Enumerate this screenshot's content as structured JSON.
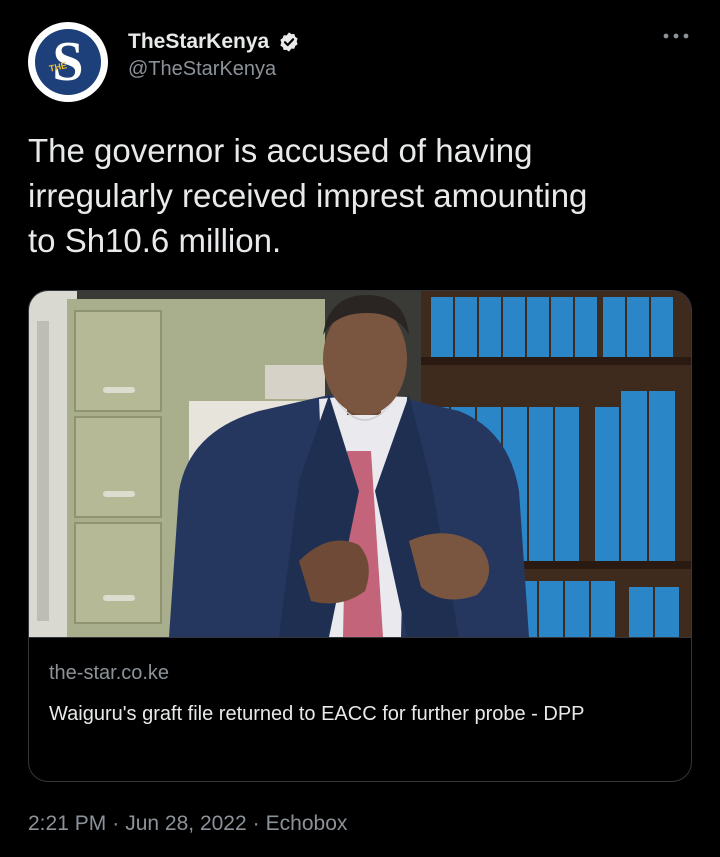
{
  "account": {
    "display_name": "TheStarKenya",
    "handle": "@TheStarKenya",
    "verified": true,
    "avatar_letter": "S",
    "avatar_tag": "THE"
  },
  "tweet": {
    "text": "The governor is accused of having\nirregularly received imprest amounting\nto Sh10.6 million."
  },
  "link_card": {
    "domain": "the-star.co.ke",
    "title": "Waiguru's graft file returned to EACC for further probe - DPP"
  },
  "meta": {
    "time": "2:21 PM",
    "separator": "·",
    "date": "Jun 28, 2022",
    "source": "Echobox"
  },
  "colors": {
    "background": "#000000",
    "text": "#e7e9ea",
    "secondary": "#8b9298",
    "verified": "#e7e9ea",
    "border": "#33373b",
    "avatar_blue": "#1d3f7a"
  },
  "icons": {
    "verified": "verified-badge-icon",
    "more": "more-options-icon"
  }
}
